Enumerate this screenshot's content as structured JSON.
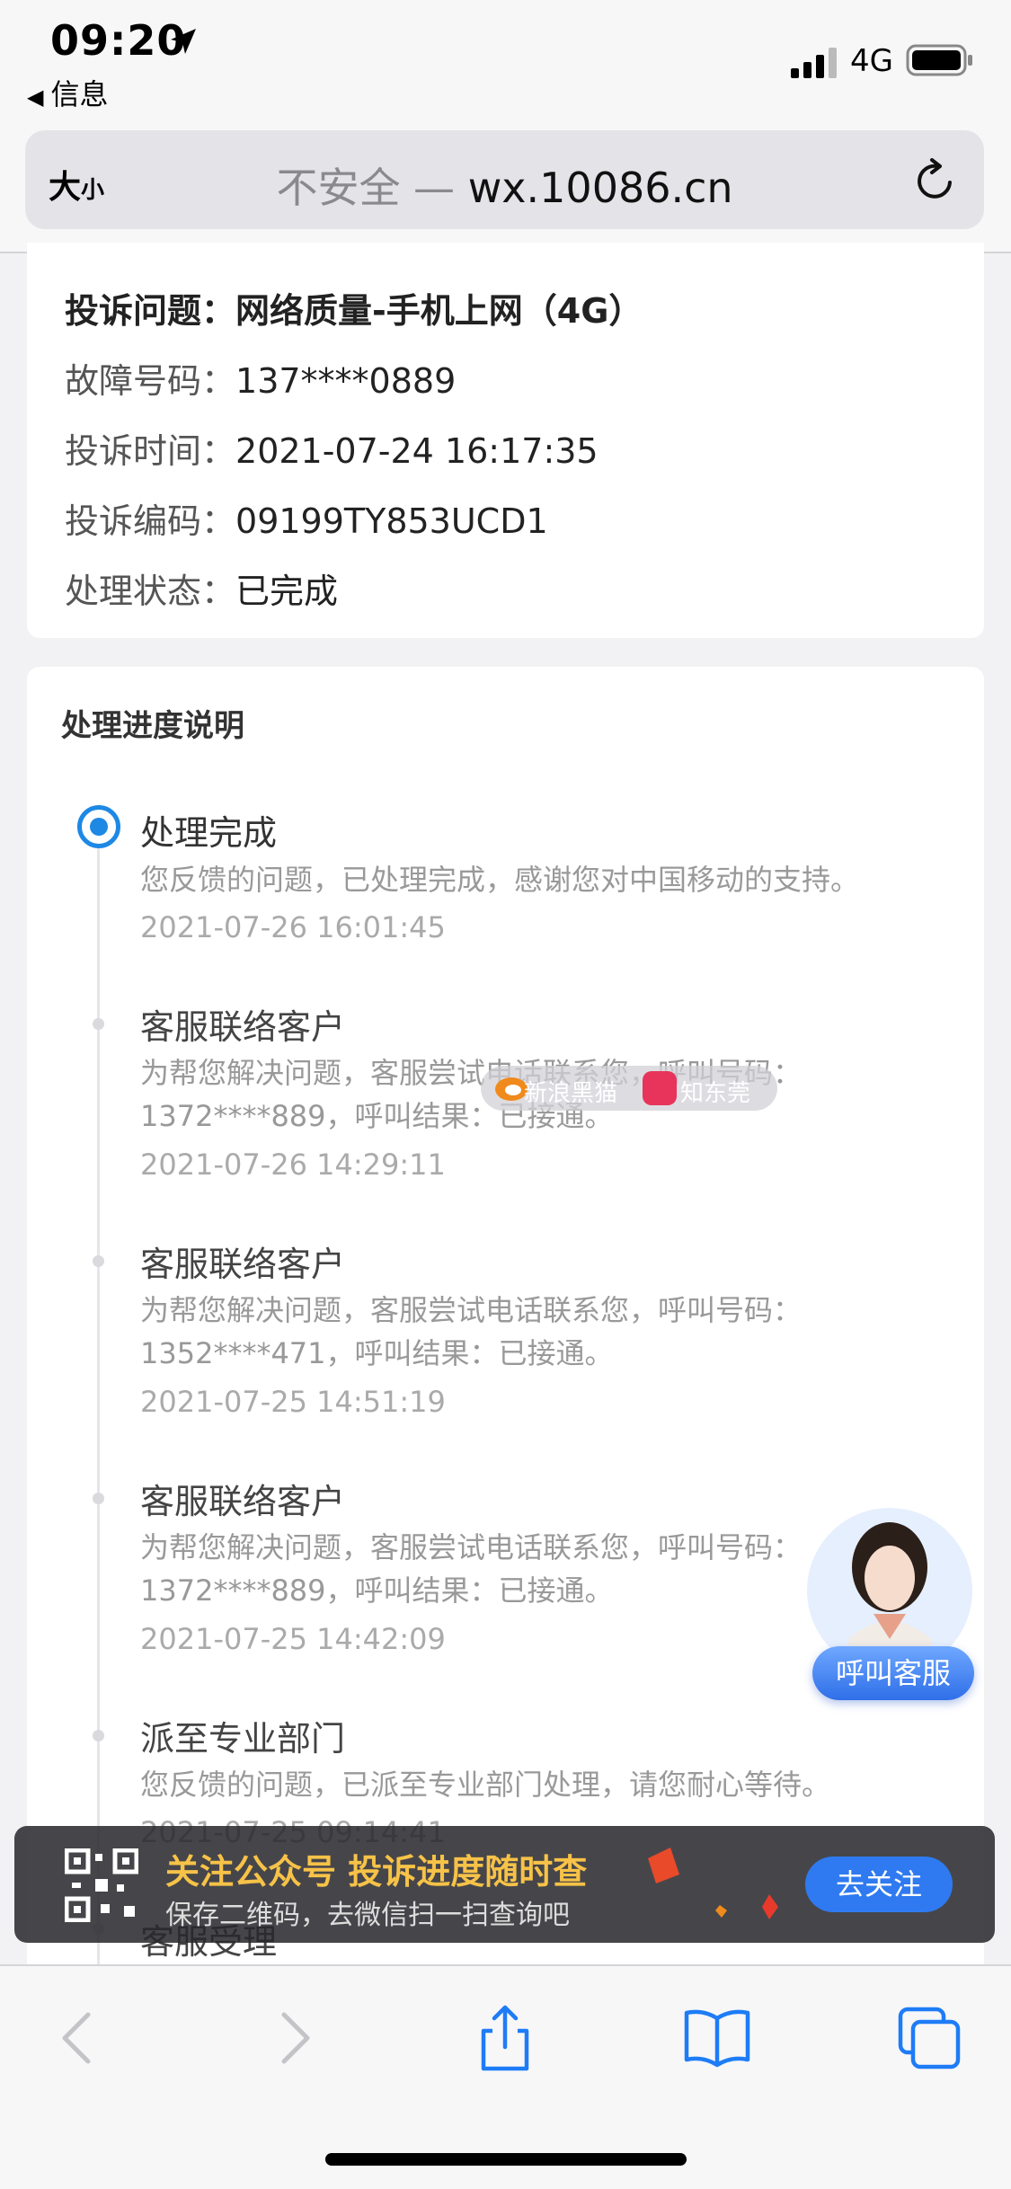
{
  "status_bar": {
    "time": "09:20",
    "back_app": "信息",
    "network": "4G"
  },
  "browser": {
    "text_size_big": "大",
    "text_size_small": "小",
    "security": "不安全",
    "separator": " — ",
    "host": "wx.10086.cn"
  },
  "complaint_info": {
    "issue_label": "投诉问题：",
    "issue_value": "网络质量-手机上网（4G）",
    "number_label": "故障号码：",
    "number_value": "137****0889",
    "time_label": "投诉时间：",
    "time_value": "2021-07-24 16:17:35",
    "code_label": "投诉编码：",
    "code_value": "09199TY853UCD1",
    "status_label": "处理状态：",
    "status_value": "已完成"
  },
  "progress": {
    "title": "处理进度说明",
    "steps": [
      {
        "title": "处理完成",
        "desc": "您反馈的问题，已处理完成，感谢您对中国移动的支持。",
        "time": "2021-07-26 16:01:45"
      },
      {
        "title": "客服联络客户",
        "desc": "为帮您解决问题，客服尝试电话联系您，呼叫号码：1372****889，呼叫结果：已接通。",
        "time": "2021-07-26 14:29:11"
      },
      {
        "title": "客服联络客户",
        "desc": "为帮您解决问题，客服尝试电话联系您，呼叫号码：1352****471，呼叫结果：已接通。",
        "time": "2021-07-25 14:51:19"
      },
      {
        "title": "客服联络客户",
        "desc": "为帮您解决问题，客服尝试电话联系您，呼叫号码：1372****889，呼叫结果：已接通。",
        "time": "2021-07-25 14:42:09"
      },
      {
        "title": "派至专业部门",
        "desc": "您反馈的问题，已派至专业部门处理，请您耐心等待。",
        "time": "2021-07-25 09:14:41"
      },
      {
        "title": "客服受理"
      }
    ]
  },
  "watermark": {
    "site1": "新浪黑猫",
    "site2": "知东莞"
  },
  "float_service": {
    "label": "呼叫客服"
  },
  "banner": {
    "title": "关注公众号 投诉进度随时查",
    "subtitle": "保存二维码，去微信扫一扫查询吧",
    "button": "去关注"
  },
  "colors": {
    "accent": "#1e88e5",
    "banner_title": "#f7c248"
  }
}
